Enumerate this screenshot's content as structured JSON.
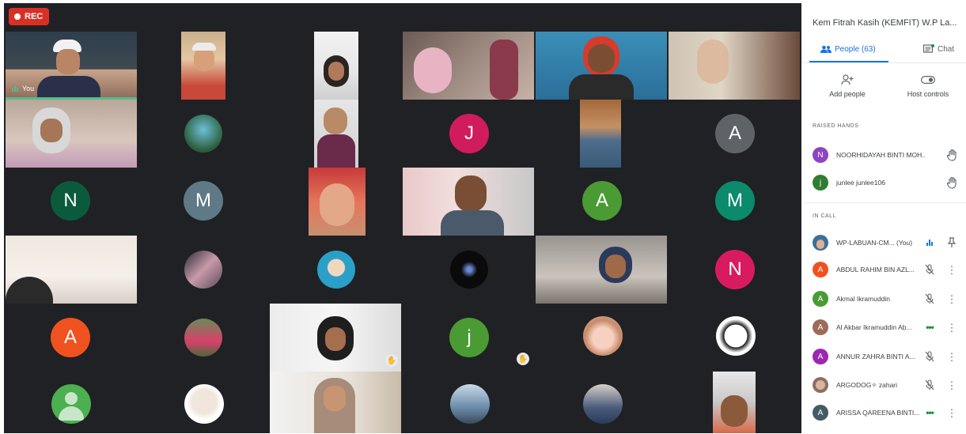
{
  "recording": {
    "label": "REC"
  },
  "grid": {
    "you_label": "You",
    "tiles": [
      {
        "initial": "J",
        "color": "#d01c5c"
      },
      {
        "initial": "A",
        "color": "#5f6368"
      },
      {
        "initial": "N",
        "color": "#0b5a3e"
      },
      {
        "initial": "M",
        "color": "#5f7a86"
      },
      {
        "initial": "A",
        "color": "#4a9b33"
      },
      {
        "initial": "M",
        "color": "#0b8a6c"
      },
      {
        "initial": "N",
        "color": "#d81b60"
      },
      {
        "initial": "A",
        "color": "#f0521f"
      },
      {
        "initial": "j",
        "color": "#4a9b33"
      }
    ]
  },
  "panel": {
    "meeting_title": "Kem Fitrah Kasih (KEMFIT) W.P La...",
    "tabs": {
      "people": "People (63)",
      "chat": "Chat"
    },
    "actions": {
      "add_people": "Add people",
      "host_controls": "Host controls"
    },
    "raised_hands_header": "RAISED HANDS",
    "raised_hands": [
      {
        "initial": "N",
        "color": "#8e44c4",
        "name": "NOORHIDAYAH BINTI MOH..."
      },
      {
        "initial": "j",
        "color": "#2e7d32",
        "name": "junlee junlee106"
      }
    ],
    "in_call_header": "IN CALL",
    "in_call": [
      {
        "initial": "",
        "color": "#3b6f9c",
        "name": "WP-LABUAN-CM...",
        "suffix": "(You)",
        "status": "speaking",
        "menu": "pin"
      },
      {
        "initial": "A",
        "color": "#f0521f",
        "name": "ABDUL RAHIM BIN AZL...",
        "status": "muted",
        "menu": "more"
      },
      {
        "initial": "A",
        "color": "#4a9b33",
        "name": "Akmal Ikramuddin",
        "status": "muted",
        "menu": "more"
      },
      {
        "initial": "A",
        "color": "#9c6b5a",
        "name": "Al Akbar Ikramuddin Ab...",
        "status": "dots",
        "menu": "more"
      },
      {
        "initial": "A",
        "color": "#9c27b0",
        "name": "ANNUR ZAHRA BINTI A...",
        "status": "muted",
        "menu": "more"
      },
      {
        "initial": "",
        "color": "#8d6e63",
        "name": "ARGODOG✧ zahari",
        "status": "muted",
        "menu": "more"
      },
      {
        "initial": "A",
        "color": "#455a64",
        "name": "ARISSA QAREENA BINTI...",
        "status": "dots",
        "menu": "more"
      }
    ]
  },
  "colors": {
    "accent": "#1a73e8",
    "speaking": "#57bb8a",
    "record": "#d93025",
    "stage": "#202124"
  }
}
